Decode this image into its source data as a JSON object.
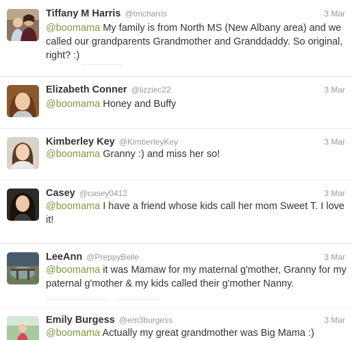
{
  "tweets": [
    {
      "name": "Tiffany M Harris",
      "handle": "@tmcharris",
      "time": "3 Mar",
      "mention": "@boomama",
      "text": " My family is from North MS (New Albany area) and we called our grandparents Grandmother and Granddaddy. So original, right? :)"
    },
    {
      "name": "Elizabeth Conner",
      "handle": "@lizziec22",
      "time": "3 Mar",
      "mention": "@boomama",
      "text": " Honey and Buffy"
    },
    {
      "name": "Kimberley Key",
      "handle": "@KimberleyKey",
      "time": "3 Mar",
      "mention": "@boomama",
      "text": " Granny :) and miss her so!"
    },
    {
      "name": "Casey",
      "handle": "@casey0412",
      "time": "3 Mar",
      "mention": "@boomama",
      "text": " I have a friend whose kids call her mom Sweet T. I love it!"
    },
    {
      "name": "LeeAnn",
      "handle": "@PreppyBelle",
      "time": "3 Mar",
      "mention": "@boomama",
      "text": " it was Mamaw for my maternal g'mother, Granny for my paternal g'mother & my kids called their g'mother Nanny."
    },
    {
      "name": "Emily Burgess",
      "handle": "@em3burgess",
      "time": "3 Mar",
      "mention": "@boomama",
      "text": " Actually my great grandmother was Big Mama :)"
    }
  ],
  "colors": {
    "mention": "#7a9a3a",
    "name": "#333333",
    "meta": "#999999",
    "divider": "#e8e8e8"
  },
  "icons": [
    "avatar-photo"
  ]
}
